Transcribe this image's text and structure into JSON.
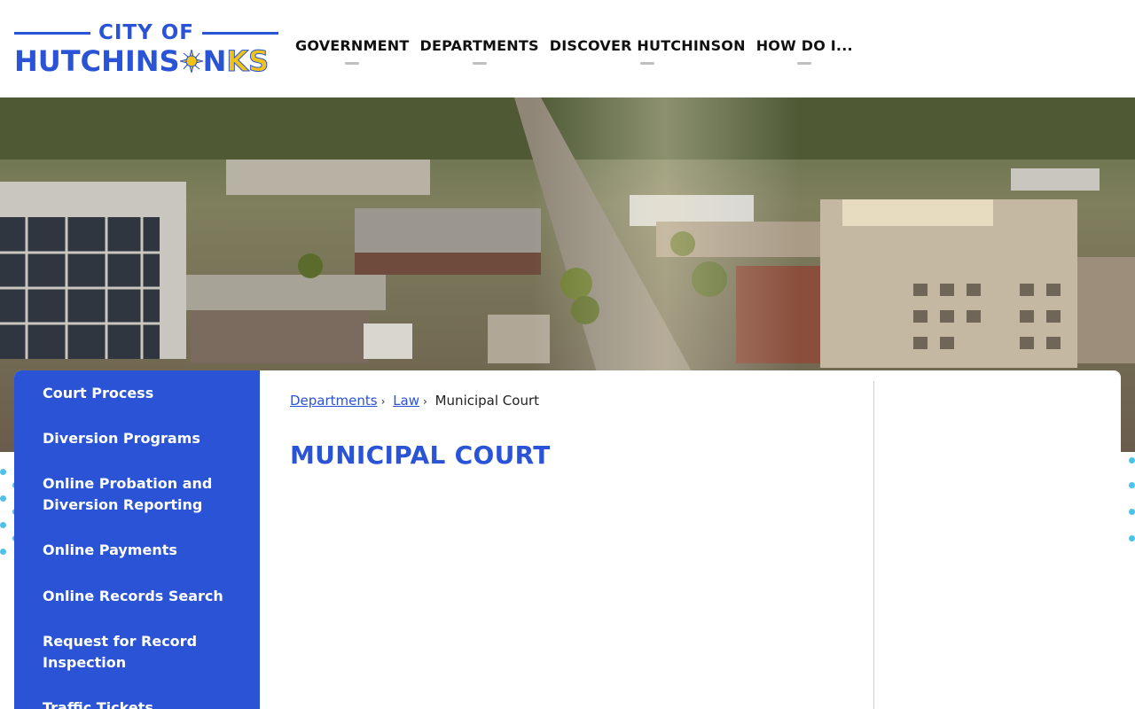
{
  "logo": {
    "city_of": "CITY OF",
    "name_main": "HUTCHINS",
    "name_after_sun": "N",
    "state": "KS"
  },
  "nav": [
    {
      "label": "GOVERNMENT"
    },
    {
      "label": "DEPARTMENTS"
    },
    {
      "label": "DISCOVER HUTCHINSON"
    },
    {
      "label": "HOW DO I..."
    }
  ],
  "sidebar": {
    "items": [
      {
        "label": "Court Process"
      },
      {
        "label": "Diversion Programs"
      },
      {
        "label": "Online Probation and Diversion Reporting"
      },
      {
        "label": "Online Payments"
      },
      {
        "label": "Online Records Search"
      },
      {
        "label": "Request for Record Inspection"
      },
      {
        "label": "Traffic Tickets"
      }
    ]
  },
  "breadcrumb": {
    "items": [
      {
        "label": "Departments"
      },
      {
        "label": "Law"
      },
      {
        "label": "Municipal Court"
      }
    ],
    "separator": "›"
  },
  "page": {
    "title": "MUNICIPAL COURT"
  },
  "colors": {
    "brand_blue": "#2a53d6",
    "accent_yellow": "#f2c317",
    "dot_cyan": "#4ec1e9"
  }
}
